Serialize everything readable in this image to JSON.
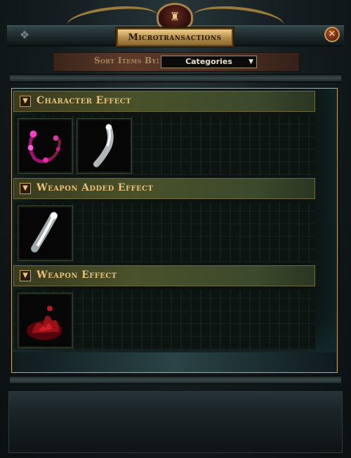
{
  "window": {
    "title": "Microtransactions",
    "crest_icon": "chair-icon",
    "corner_icon": "gem-icon",
    "close_icon": "close-icon"
  },
  "sort": {
    "label": "Sort Items By:",
    "selected": "Categories"
  },
  "categories": [
    {
      "name": "Character Effect",
      "items": [
        {
          "icon": "magenta-ring-effect-icon",
          "color": "#d12ca0"
        },
        {
          "icon": "white-smoke-effect-icon",
          "color": "#d8dde0"
        }
      ]
    },
    {
      "name": "Weapon Added Effect",
      "items": [
        {
          "icon": "white-streak-effect-icon",
          "color": "#e8eef2"
        }
      ]
    },
    {
      "name": "Weapon Effect",
      "items": [
        {
          "icon": "red-flame-effect-icon",
          "color": "#b3141c"
        }
      ]
    }
  ]
}
